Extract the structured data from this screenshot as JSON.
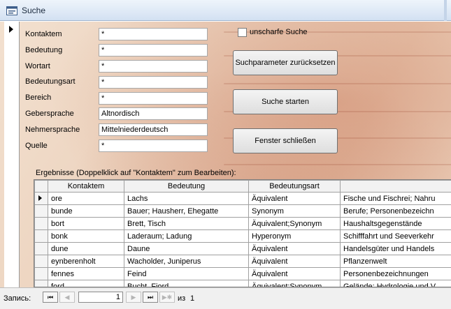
{
  "window": {
    "title": "Suche"
  },
  "fields": [
    {
      "label": "Kontaktem",
      "value": "*"
    },
    {
      "label": "Bedeutung",
      "value": "*"
    },
    {
      "label": "Wortart",
      "value": "*"
    },
    {
      "label": "Bedeutungsart",
      "value": "*"
    },
    {
      "label": "Bereich",
      "value": "*"
    },
    {
      "label": "Gebersprache",
      "value": "Altnordisch"
    },
    {
      "label": "Nehmersprache",
      "value": "Mittelniederdeutsch"
    },
    {
      "label": "Quelle",
      "value": "*"
    }
  ],
  "options": {
    "fuzzy_label": "unscharfe Suche",
    "fuzzy_checked": false
  },
  "buttons": {
    "reset": "Suchparameter zurücksetzen",
    "start": "Suche starten",
    "close": "Fenster schließen"
  },
  "results": {
    "label": "Ergebnisse (Doppelklick auf \"Kontaktem\" zum Bearbeiten):",
    "columns": [
      "Kontaktem",
      "Bedeutung",
      "Bedeutungsart",
      ""
    ],
    "rows": [
      [
        "ore",
        "Lachs",
        "Äquivalent",
        "Fische und Fischrei; Nahru"
      ],
      [
        "bunde",
        "Bauer; Hausherr, Ehegatte",
        "Synonym",
        "Berufe; Personenbezeichn"
      ],
      [
        "bort",
        "Brett, Tisch",
        "Äquivalent;Synonym",
        "Haushaltsgegenstände"
      ],
      [
        "bonk",
        "Laderaum; Ladung",
        "Hyperonym",
        "Schifffahrt und Seeverkehr"
      ],
      [
        "dune",
        "Daune",
        "Äquivalent",
        "Handelsgüter und Handels"
      ],
      [
        "eynberenholt",
        "Wacholder, Juniperus",
        "Äquivalent",
        "Pflanzenwelt"
      ],
      [
        "fennes",
        "Feind",
        "Äquivalent",
        "Personenbezeichnungen"
      ],
      [
        "ford",
        "Bucht, Fjord",
        "Äquivalent;Synonym",
        "Gelände; Hydrologie und V"
      ]
    ]
  },
  "navigation": {
    "label": "Запись:",
    "first": "⏮",
    "prev": "◀",
    "next": "▶",
    "last": "⏭",
    "new": "▶✱",
    "current": "1",
    "of": "из",
    "total": "1"
  },
  "colors": {
    "titlebar": "#d3e1f2",
    "background": "#ecd2bd",
    "grid": "#ffffff"
  }
}
